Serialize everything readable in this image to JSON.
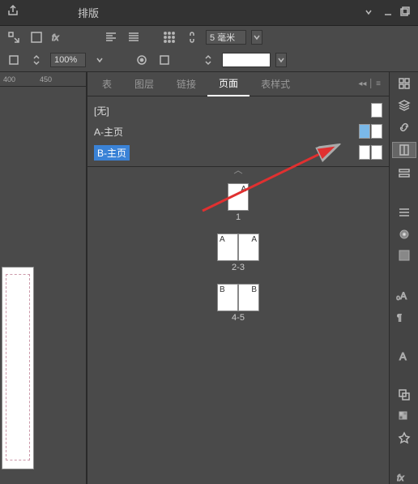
{
  "top_menu": {
    "layout_label": "排版",
    "share_icon": "share-icon"
  },
  "toolbar": {
    "row1": {
      "size_value": "5 毫米"
    },
    "row2": {
      "opacity_value": "100%"
    }
  },
  "ruler": {
    "marks": [
      "400",
      "450"
    ]
  },
  "panel_tabs": {
    "table": "表",
    "layers": "图层",
    "links": "链接",
    "pages": "页面",
    "table_styles": "表样式"
  },
  "masters": {
    "none": "[无]",
    "a": "A-主页",
    "b": "B-主页"
  },
  "spreads": {
    "s1": {
      "letter": "A",
      "num": "1"
    },
    "s2": {
      "letter_l": "A",
      "letter_r": "A",
      "num": "2-3"
    },
    "s3": {
      "letter_l": "B",
      "letter_r": "B",
      "num": "4-5"
    }
  }
}
